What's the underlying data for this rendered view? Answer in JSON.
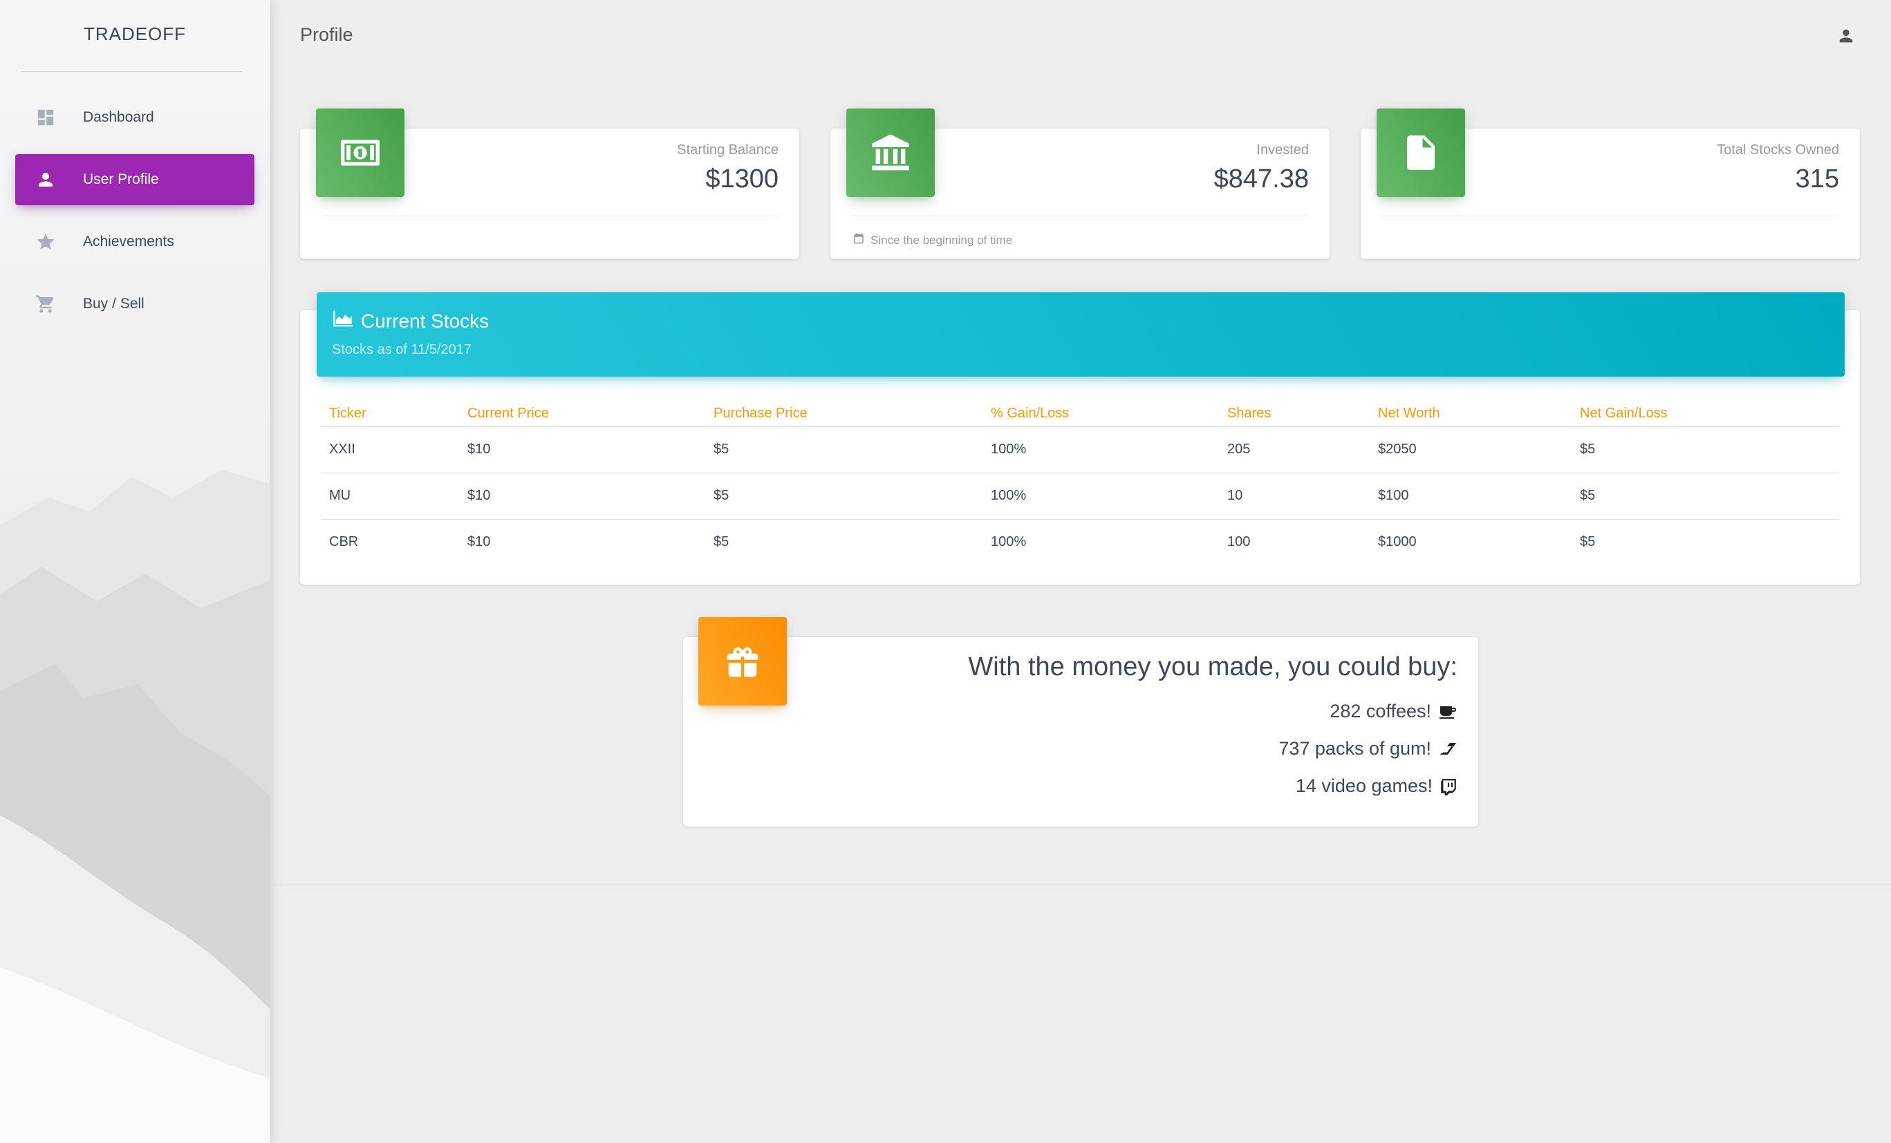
{
  "app": {
    "brand": "TRADEOFF",
    "page_title": "Profile"
  },
  "sidebar": {
    "items": [
      {
        "label": "Dashboard",
        "icon": "dashboard-icon",
        "active": false
      },
      {
        "label": "User Profile",
        "icon": "person-icon",
        "active": true
      },
      {
        "label": "Achievements",
        "icon": "star-icon",
        "active": false
      },
      {
        "label": "Buy / Sell",
        "icon": "cart-icon",
        "active": false
      }
    ],
    "accent_color": "#9c27b0"
  },
  "stats": [
    {
      "label": "Starting Balance",
      "value": "$1300",
      "icon": "money-icon",
      "footer": ""
    },
    {
      "label": "Invested",
      "value": "$847.38",
      "icon": "bank-icon",
      "footer": "Since the beginning of time"
    },
    {
      "label": "Total Stocks Owned",
      "value": "315",
      "icon": "document-icon",
      "footer": ""
    }
  ],
  "stocks": {
    "title": "Current Stocks",
    "subtitle": "Stocks as of 11/5/2017",
    "columns": [
      "Ticker",
      "Current Price",
      "Purchase Price",
      "% Gain/Loss",
      "Shares",
      "Net Worth",
      "Net Gain/Loss"
    ],
    "rows": [
      [
        "XXII",
        "$10",
        "$5",
        "100%",
        "205",
        "$2050",
        "$5"
      ],
      [
        "MU",
        "$10",
        "$5",
        "100%",
        "10",
        "$100",
        "$5"
      ],
      [
        "CBR",
        "$10",
        "$5",
        "100%",
        "100",
        "$1000",
        "$5"
      ]
    ],
    "header_color": "#00acc1",
    "column_header_color": "#ff9800"
  },
  "fun": {
    "title": "With the money you made, you could buy:",
    "lines": [
      {
        "text": "282 coffees!",
        "icon": "coffee-icon"
      },
      {
        "text": "737 packs of gum!",
        "icon": "eraser-icon"
      },
      {
        "text": "14 video games!",
        "icon": "twitch-icon"
      }
    ],
    "icon": "gift-icon"
  }
}
